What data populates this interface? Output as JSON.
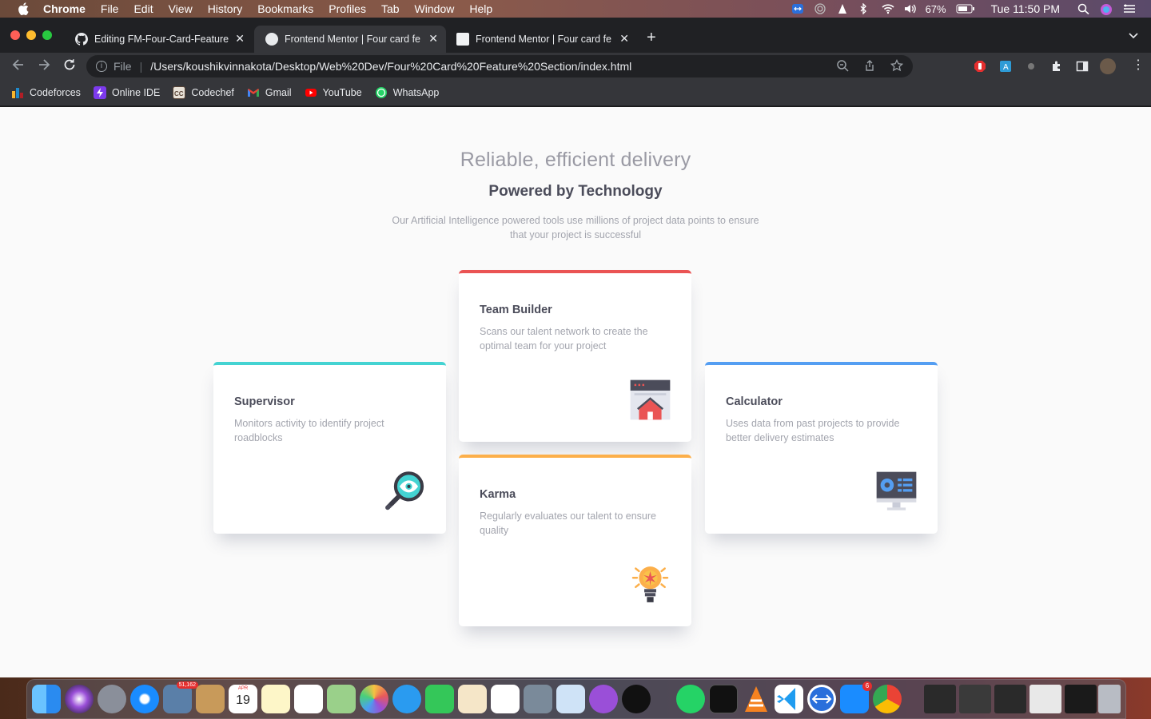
{
  "menubar": {
    "app": "Chrome",
    "items": [
      "File",
      "Edit",
      "View",
      "History",
      "Bookmarks",
      "Profiles",
      "Tab",
      "Window",
      "Help"
    ],
    "battery": "67%",
    "clock": "Tue 11:50 PM"
  },
  "tabs": [
    {
      "title": "Editing FM-Four-Card-Feature",
      "icon": "github-icon"
    },
    {
      "title": "Frontend Mentor | Four card fe",
      "icon": "globe-icon"
    },
    {
      "title": "Frontend Mentor | Four card fe",
      "icon": "page-icon"
    }
  ],
  "address": {
    "scheme_label": "File",
    "url": "/Users/koushikvinnakota/Desktop/Web%20Dev/Four%20Card%20Feature%20Section/index.html"
  },
  "bookmarks": [
    {
      "label": "Codeforces",
      "color": "#1f8acb"
    },
    {
      "label": "Online IDE",
      "color": "#7c3aed"
    },
    {
      "label": "Codechef",
      "color": "#5b4638"
    },
    {
      "label": "Gmail",
      "color": "#ea4335"
    },
    {
      "label": "YouTube",
      "color": "#ff0000"
    },
    {
      "label": "WhatsApp",
      "color": "#25d366"
    }
  ],
  "page": {
    "heading_light": "Reliable, efficient delivery",
    "heading_bold": "Powered by Technology",
    "intro": "Our Artificial Intelligence powered tools use millions of project data points to ensure that your project is successful",
    "cards": {
      "supervisor": {
        "title": "Supervisor",
        "desc": "Monitors activity to identify project roadblocks",
        "accent": "#44d3d2",
        "icon": "magnifier-eye-icon"
      },
      "team_builder": {
        "title": "Team Builder",
        "desc": "Scans our talent network to create the optimal team for your project",
        "accent": "#ea5454",
        "icon": "team-builder-icon"
      },
      "karma": {
        "title": "Karma",
        "desc": "Regularly evaluates our talent to ensure quality",
        "accent": "#fcaf4a",
        "icon": "lightbulb-icon"
      },
      "calculator": {
        "title": "Calculator",
        "desc": "Uses data from past projects to provide better delivery estimates",
        "accent": "#549ef2",
        "icon": "calculator-monitor-icon"
      }
    }
  },
  "dock": {
    "mail_badge": "51,162",
    "calendar_day": "19",
    "calendar_month": "APR",
    "appstore_badge": "6"
  }
}
